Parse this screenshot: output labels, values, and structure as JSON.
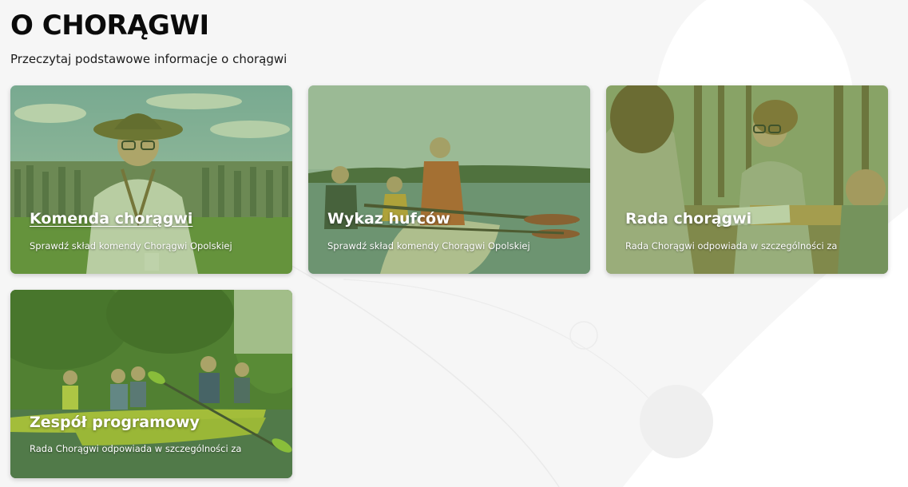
{
  "page": {
    "title": "O CHORĄGWI",
    "subtitle": "Przeczytaj podstawowe informacje o chorągwi"
  },
  "cards": [
    {
      "title": "Komenda chorągwi",
      "description": "Sprawdź skład komendy Chorągwi Opolskiej",
      "image": "scout-with-hat-photo"
    },
    {
      "title": "Wykaz hufców",
      "description": "Sprawdź skład komendy Chorągwi Opolskiej",
      "image": "kayaking-on-lake-photo"
    },
    {
      "title": "Rada chorągwi",
      "description": "Rada Chorągwi odpowiada w szczególności za",
      "image": "scouts-in-forest-photo"
    },
    {
      "title": "Zespół programowy",
      "description": "Rada Chorągwi odpowiada w szczególności za",
      "image": "kayaks-on-river-photo"
    }
  ],
  "colors": {
    "page_background": "#f6f6f6",
    "card_tint": "#6ea03c",
    "card_text": "#ffffff"
  }
}
